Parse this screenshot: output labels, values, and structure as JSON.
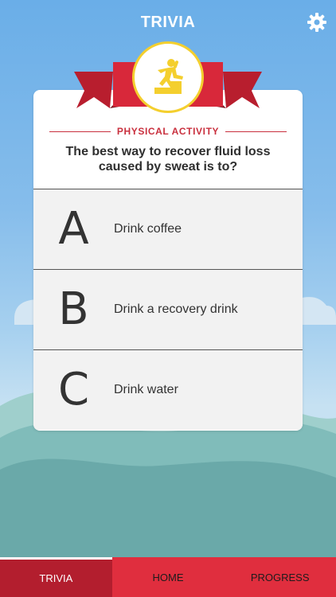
{
  "header": {
    "title": "TRIVIA",
    "settings_icon": "gear-icon"
  },
  "colors": {
    "accent": "#e02e3e",
    "accent_dark": "#b31e2e",
    "badge_border": "#f4cf2e",
    "icon_yellow": "#f4cf2e"
  },
  "card": {
    "category_icon": "person-climbing-steps-icon",
    "category": "PHYSICAL ACTIVITY",
    "question": "The best way to recover fluid loss caused by sweat is to?",
    "answers": [
      {
        "letter": "A",
        "text": "Drink coffee"
      },
      {
        "letter": "B",
        "text": "Drink a recovery drink"
      },
      {
        "letter": "C",
        "text": "Drink water"
      }
    ]
  },
  "tabs": [
    {
      "label": "TRIVIA",
      "active": true
    },
    {
      "label": "HOME",
      "active": false
    },
    {
      "label": "PROGRESS",
      "active": false
    }
  ]
}
